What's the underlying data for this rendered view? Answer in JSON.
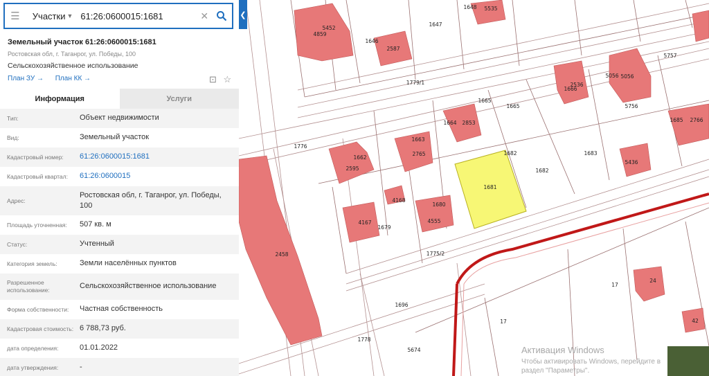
{
  "search": {
    "category": "Участки",
    "query": "61:26:0600015:1681"
  },
  "info": {
    "title": "Земельный участок 61:26:0600015:1681",
    "address": "Ростовская обл, г. Таганрог, ул. Победы, 100",
    "usage": "Сельскохозяйственное использование",
    "links": [
      "План ЗУ →",
      "План КК →"
    ]
  },
  "tabs": [
    "Информация",
    "Услуги"
  ],
  "rows": [
    {
      "label": "Тип:",
      "value": "Объект недвижимости"
    },
    {
      "label": "Вид:",
      "value": "Земельный участок"
    },
    {
      "label": "Кадастровый номер:",
      "value": "61:26:0600015:1681"
    },
    {
      "label": "Кадастровый квартал:",
      "value": "61:26:0600015"
    },
    {
      "label": "Адрес:",
      "value": "Ростовская обл, г. Таганрог, ул. Победы, 100"
    },
    {
      "label": "Площадь уточненная:",
      "value": "507 кв. м"
    },
    {
      "label": "Статус:",
      "value": "Учтенный"
    },
    {
      "label": "Категория земель:",
      "value": "Земли населённых пунктов"
    },
    {
      "label": "Разрешенное использование:",
      "value": "Сельскохозяйственное использование"
    },
    {
      "label": "Форма собственности:",
      "value": "Частная собственность"
    },
    {
      "label": "Кадастровая стоимость:",
      "value": "6 788,73 руб."
    },
    {
      "label": "дата определения:",
      "value": "01.01.2022"
    },
    {
      "label": "дата утверждения:",
      "value": "-"
    }
  ],
  "map": {
    "parcel_numbers": [
      "1779/1",
      "1647",
      "1648",
      "5535",
      "5452",
      "4859",
      "1646",
      "2587",
      "5757",
      "1665",
      "1665",
      "2536",
      "1666",
      "5056",
      "5056",
      "5756",
      "1776",
      "1664",
      "2853",
      "1663",
      "2765",
      "1662",
      "2595",
      "1685",
      "2766",
      "1681",
      "1682",
      "1683",
      "1682",
      "5436",
      "4168",
      "1680",
      "4555",
      "4167",
      "1679",
      "1775/2",
      "2458",
      "1696",
      "17",
      "24",
      "17",
      "42",
      "1778",
      "5674"
    ],
    "selected_parcel": "1681"
  },
  "watermark": {
    "title": "Активация Windows",
    "text": "Чтобы активировать Windows, перейдите в раздел \"Параметры\"."
  },
  "colors": {
    "accent": "#1f6fbf",
    "parcel": "#e77878",
    "selected": "#f5f56a"
  }
}
